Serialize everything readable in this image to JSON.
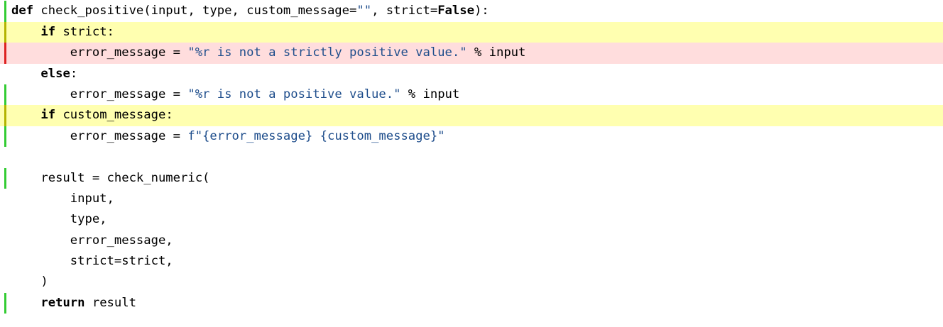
{
  "colors": {
    "background": "#ffffff",
    "text": "#000000",
    "keyword": "#000000",
    "string": "#1f4e8c",
    "line_highlight_partial": "#ffffb0",
    "line_highlight_missed": "#ffdddd",
    "gutter_covered": "#33cc33",
    "gutter_partial": "#b3b300",
    "gutter_missed": "#dd2222"
  },
  "code_view": {
    "lines": [
      {
        "status": "covered",
        "tokens": [
          {
            "text": "def",
            "kind": "kw"
          },
          {
            "text": " check_positive(input, type, custom_message=",
            "kind": "plain"
          },
          {
            "text": "\"\"",
            "kind": "str"
          },
          {
            "text": ", strict=",
            "kind": "plain"
          },
          {
            "text": "False",
            "kind": "kw"
          },
          {
            "text": "):",
            "kind": "plain"
          }
        ]
      },
      {
        "status": "partial",
        "tokens": [
          {
            "text": "    ",
            "kind": "plain"
          },
          {
            "text": "if",
            "kind": "kw"
          },
          {
            "text": " strict:",
            "kind": "plain"
          }
        ]
      },
      {
        "status": "missed",
        "tokens": [
          {
            "text": "        error_message = ",
            "kind": "plain"
          },
          {
            "text": "\"%r is not a strictly positive value.\"",
            "kind": "str"
          },
          {
            "text": " % input",
            "kind": "plain"
          }
        ]
      },
      {
        "status": "none",
        "tokens": [
          {
            "text": "    ",
            "kind": "plain"
          },
          {
            "text": "else",
            "kind": "kw"
          },
          {
            "text": ":",
            "kind": "plain"
          }
        ]
      },
      {
        "status": "covered",
        "tokens": [
          {
            "text": "        error_message = ",
            "kind": "plain"
          },
          {
            "text": "\"%r is not a positive value.\"",
            "kind": "str"
          },
          {
            "text": " % input",
            "kind": "plain"
          }
        ]
      },
      {
        "status": "partial",
        "tokens": [
          {
            "text": "    ",
            "kind": "plain"
          },
          {
            "text": "if",
            "kind": "kw"
          },
          {
            "text": " custom_message:",
            "kind": "plain"
          }
        ]
      },
      {
        "status": "covered",
        "tokens": [
          {
            "text": "        error_message = ",
            "kind": "plain"
          },
          {
            "text": "f\"{error_message} {custom_message}\"",
            "kind": "str"
          }
        ]
      },
      {
        "status": "none",
        "tokens": []
      },
      {
        "status": "covered",
        "tokens": [
          {
            "text": "    result = check_numeric(",
            "kind": "plain"
          }
        ]
      },
      {
        "status": "none",
        "tokens": [
          {
            "text": "        input,",
            "kind": "plain"
          }
        ]
      },
      {
        "status": "none",
        "tokens": [
          {
            "text": "        type,",
            "kind": "plain"
          }
        ]
      },
      {
        "status": "none",
        "tokens": [
          {
            "text": "        error_message,",
            "kind": "plain"
          }
        ]
      },
      {
        "status": "none",
        "tokens": [
          {
            "text": "        strict=strict,",
            "kind": "plain"
          }
        ]
      },
      {
        "status": "none",
        "tokens": [
          {
            "text": "    )",
            "kind": "plain"
          }
        ]
      },
      {
        "status": "covered",
        "tokens": [
          {
            "text": "    ",
            "kind": "plain"
          },
          {
            "text": "return",
            "kind": "kw"
          },
          {
            "text": " result",
            "kind": "plain"
          }
        ]
      }
    ]
  }
}
